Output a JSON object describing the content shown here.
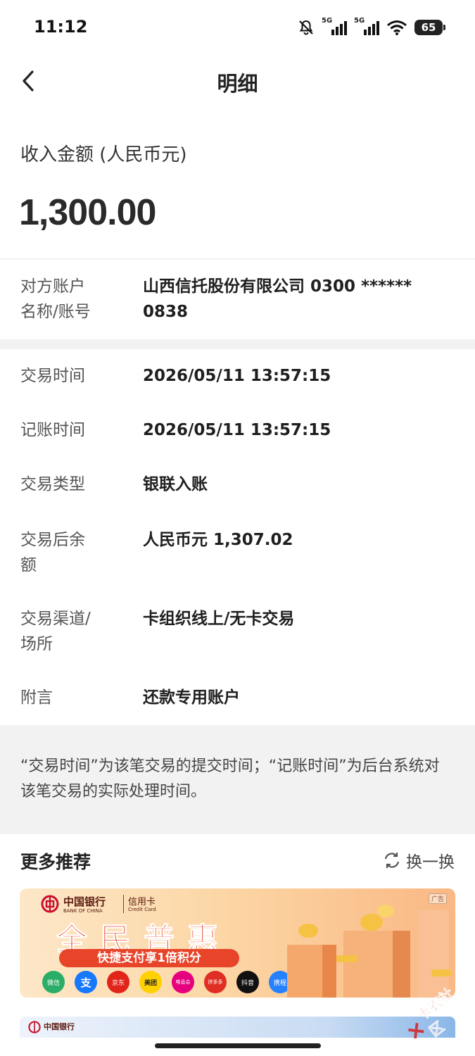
{
  "status_bar": {
    "time": "11:12",
    "battery": "65",
    "network_1": "5G",
    "network_2": "5G"
  },
  "nav": {
    "title": "明细"
  },
  "summary": {
    "amount_label": "收入金额 (人民币元)",
    "amount_value": "1,300.00"
  },
  "counterparty": {
    "label_line1": "对方账户",
    "label_line2": "名称/账号",
    "value_line1": "山西信托股份有限公司 0300 ******",
    "value_line2": "0838"
  },
  "details": [
    {
      "label": "交易时间",
      "value": "2026/05/11 13:57:15"
    },
    {
      "label": "记账时间",
      "value": "2026/05/11 13:57:15"
    },
    {
      "label": "交易类型",
      "value": "银联入账"
    },
    {
      "label_line1": "交易后余",
      "label_line2": "额",
      "value": "人民币元 1,307.02"
    },
    {
      "label_line1": "交易渠道/",
      "label_line2": "场所",
      "value": "卡组织线上/无卡交易"
    },
    {
      "label": "附言",
      "value": "还款专用账户"
    }
  ],
  "note": "“交易时间”为该笔交易的提交时间；“记账时间”为后台系统对该笔交易的实际处理时间。",
  "recommend": {
    "title": "更多推荐",
    "refresh_label": "换一换",
    "banner1": {
      "bank_name": "中国银行",
      "bank_en": "BANK OF CHINA",
      "card_type": "信用卡",
      "card_en": "Credit Card",
      "ad_tag": "广告",
      "headline": "全民普惠",
      "subline": "快捷支付享1倍积分",
      "brands": [
        "微信",
        "支",
        "京东",
        "美团",
        "唯品会",
        "拼多多",
        "抖音",
        "携程"
      ]
    },
    "banner2": {
      "bank_name": "中国银行"
    }
  },
  "watermark": "卡农社区",
  "colors": {
    "banner_red": "#e8442a",
    "banner_orange": "#f9b884",
    "page_gray": "#f2f2f2"
  }
}
